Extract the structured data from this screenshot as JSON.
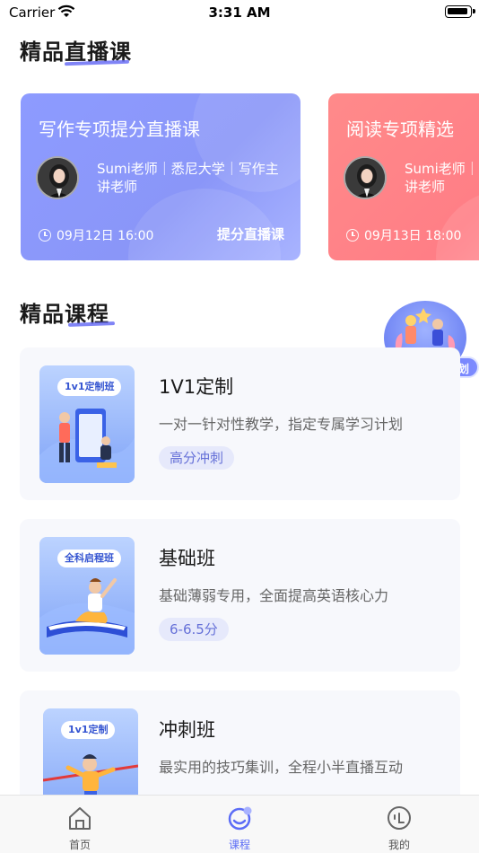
{
  "status_bar": {
    "carrier": "Carrier",
    "time": "3:31 AM"
  },
  "live_section": {
    "title": "精品直播课",
    "cards": [
      {
        "title": "写作专项提分直播课",
        "teacher": "Sumi老师｜悉尼大学｜写作主讲老师",
        "time": "09月12日 16:00",
        "tag": "提分直播课",
        "color": "#8d9bff"
      },
      {
        "title": "阅读专项精选",
        "teacher": "Sumi老师｜悉尼大学｜写作主讲老师",
        "time": "09月13日 18:00",
        "tag": "",
        "color": "#ff8a8a"
      }
    ]
  },
  "course_section": {
    "title": "精品课程",
    "courses": [
      {
        "badge": "1v1定制班",
        "name": "1V1定制",
        "desc": "一对一针对性教学，指定专属学习计划",
        "tag": "高分冲刺"
      },
      {
        "badge": "全科启程班",
        "name": "基础班",
        "desc": "基础薄弱专用，全面提高英语核心力",
        "tag": "6-6.5分"
      },
      {
        "badge": "1v1定制",
        "name": "冲刺班",
        "desc": "最实用的技巧集训，全程小半直播互动",
        "tag": ""
      }
    ]
  },
  "promo": {
    "label": "免费制定学习计划"
  },
  "tab_bar": {
    "tabs": [
      {
        "label": "首页",
        "icon": "home-icon"
      },
      {
        "label": "课程",
        "icon": "course-icon",
        "active": true
      },
      {
        "label": "我的",
        "icon": "profile-icon"
      }
    ]
  },
  "colors": {
    "accent": "#5b6cf6",
    "live_blue": "#8d9bff",
    "live_red": "#ff8a8a",
    "tag_bg": "#e6e9fb"
  }
}
